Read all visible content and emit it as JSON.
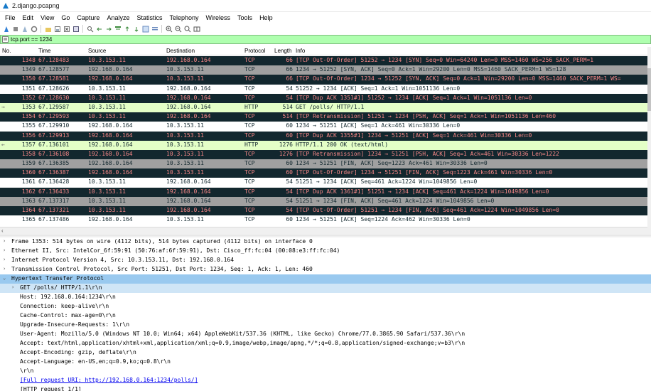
{
  "window": {
    "title": "2.django.pcapng"
  },
  "menu": [
    "File",
    "Edit",
    "View",
    "Go",
    "Capture",
    "Analyze",
    "Statistics",
    "Telephony",
    "Wireless",
    "Tools",
    "Help"
  ],
  "filter": {
    "value": "tcp.port == 1234"
  },
  "columns": {
    "no": "No.",
    "time": "Time",
    "source": "Source",
    "destination": "Destination",
    "protocol": "Protocol",
    "length": "Length",
    "info": "Info"
  },
  "packets": [
    {
      "no": "1348",
      "time": "67.128483",
      "src": "10.3.153.11",
      "dst": "192.168.0.164",
      "proto": "TCP",
      "len": "66",
      "info": "[TCP Out-Of-Order] 51252 → 1234 [SYN] Seq=0 Win=64240 Len=0 MSS=1460 WS=256 SACK_PERM=1",
      "style": "dark",
      "mark": ""
    },
    {
      "no": "1349",
      "time": "67.128577",
      "src": "192.168.0.164",
      "dst": "10.3.153.11",
      "proto": "TCP",
      "len": "66",
      "info": "1234 → 51252 [SYN, ACK] Seq=0 Ack=1 Win=29200 Len=0 MSS=1460 SACK_PERM=1 WS=128",
      "style": "gray",
      "mark": ""
    },
    {
      "no": "1350",
      "time": "67.128581",
      "src": "192.168.0.164",
      "dst": "10.3.153.11",
      "proto": "TCP",
      "len": "66",
      "info": "[TCP Out-Of-Order] 1234 → 51252 [SYN, ACK] Seq=0 Ack=1 Win=29200 Len=0 MSS=1460 SACK_PERM=1 WS=",
      "style": "dark",
      "mark": ""
    },
    {
      "no": "1351",
      "time": "67.128626",
      "src": "10.3.153.11",
      "dst": "192.168.0.164",
      "proto": "TCP",
      "len": "54",
      "info": "51252 → 1234 [ACK] Seq=1 Ack=1 Win=1051136 Len=0",
      "style": "white",
      "mark": ""
    },
    {
      "no": "1352",
      "time": "67.128630",
      "src": "10.3.153.11",
      "dst": "192.168.0.164",
      "proto": "TCP",
      "len": "54",
      "info": "[TCP Dup ACK 1351#1] 51252 → 1234 [ACK] Seq=1 Ack=1 Win=1051136 Len=0",
      "style": "dark",
      "mark": ""
    },
    {
      "no": "1353",
      "time": "67.129587",
      "src": "10.3.153.11",
      "dst": "192.168.0.164",
      "proto": "HTTP",
      "len": "514",
      "info": "GET /polls/ HTTP/1.1",
      "style": "selected",
      "mark": "→"
    },
    {
      "no": "1354",
      "time": "67.129593",
      "src": "10.3.153.11",
      "dst": "192.168.0.164",
      "proto": "TCP",
      "len": "514",
      "info": "[TCP Retransmission] 51251 → 1234 [PSH, ACK] Seq=1 Ack=1 Win=1051136 Len=460",
      "style": "dark",
      "mark": ""
    },
    {
      "no": "1355",
      "time": "67.129910",
      "src": "192.168.0.164",
      "dst": "10.3.153.11",
      "proto": "TCP",
      "len": "60",
      "info": "1234 → 51251 [ACK] Seq=1 Ack=461 Win=30336 Len=0",
      "style": "white",
      "mark": ""
    },
    {
      "no": "1356",
      "time": "67.129913",
      "src": "192.168.0.164",
      "dst": "10.3.153.11",
      "proto": "TCP",
      "len": "60",
      "info": "[TCP Dup ACK 1355#1] 1234 → 51251 [ACK] Seq=1 Ack=461 Win=30336 Len=0",
      "style": "dark",
      "mark": ""
    },
    {
      "no": "1357",
      "time": "67.136101",
      "src": "192.168.0.164",
      "dst": "10.3.153.11",
      "proto": "HTTP",
      "len": "1276",
      "info": "HTTP/1.1 200 OK  (text/html)",
      "style": "green",
      "mark": "←"
    },
    {
      "no": "1358",
      "time": "67.136108",
      "src": "192.168.0.164",
      "dst": "10.3.153.11",
      "proto": "TCP",
      "len": "1276",
      "info": "[TCP Retransmission] 1234 → 51251 [PSH, ACK] Seq=1 Ack=461 Win=30336 Len=1222",
      "style": "dark",
      "mark": ""
    },
    {
      "no": "1359",
      "time": "67.136385",
      "src": "192.168.0.164",
      "dst": "10.3.153.11",
      "proto": "TCP",
      "len": "60",
      "info": "1234 → 51251 [FIN, ACK] Seq=1223 Ack=461 Win=30336 Len=0",
      "style": "gray",
      "mark": ""
    },
    {
      "no": "1360",
      "time": "67.136387",
      "src": "192.168.0.164",
      "dst": "10.3.153.11",
      "proto": "TCP",
      "len": "60",
      "info": "[TCP Out-Of-Order] 1234 → 51251 [FIN, ACK] Seq=1223 Ack=461 Win=30336 Len=0",
      "style": "dark",
      "mark": ""
    },
    {
      "no": "1361",
      "time": "67.136428",
      "src": "10.3.153.11",
      "dst": "192.168.0.164",
      "proto": "TCP",
      "len": "54",
      "info": "51251 → 1234 [ACK] Seq=461 Ack=1224 Win=1049856 Len=0",
      "style": "white",
      "mark": ""
    },
    {
      "no": "1362",
      "time": "67.136433",
      "src": "10.3.153.11",
      "dst": "192.168.0.164",
      "proto": "TCP",
      "len": "54",
      "info": "[TCP Dup ACK 1361#1] 51251 → 1234 [ACK] Seq=461 Ack=1224 Win=1049856 Len=0",
      "style": "dark",
      "mark": ""
    },
    {
      "no": "1363",
      "time": "67.137317",
      "src": "10.3.153.11",
      "dst": "192.168.0.164",
      "proto": "TCP",
      "len": "54",
      "info": "51251 → 1234 [FIN, ACK] Seq=461 Ack=1224 Win=1049856 Len=0",
      "style": "gray",
      "mark": ""
    },
    {
      "no": "1364",
      "time": "67.137321",
      "src": "10.3.153.11",
      "dst": "192.168.0.164",
      "proto": "TCP",
      "len": "54",
      "info": "[TCP Out-Of-Order] 51251 → 1234 [FIN, ACK] Seq=461 Ack=1224 Win=1049856 Len=0",
      "style": "dark",
      "mark": ""
    },
    {
      "no": "1365",
      "time": "67.137486",
      "src": "192.168.0.164",
      "dst": "10.3.153.11",
      "proto": "TCP",
      "len": "60",
      "info": "1234 → 51251 [ACK] Seq=1224 Ack=462 Win=30336 Len=0",
      "style": "white",
      "mark": ""
    }
  ],
  "details": [
    {
      "text": "Frame 1353: 514 bytes on wire (4112 bits), 514 bytes captured (4112 bits) on interface 0",
      "indent": 0,
      "exp": "›",
      "style": ""
    },
    {
      "text": "Ethernet II, Src: IntelCor_6f:59:91 (50:76:af:6f:59:91), Dst: Cisco_ff:fc:04 (00:08:e3:ff:fc:04)",
      "indent": 0,
      "exp": "›",
      "style": ""
    },
    {
      "text": "Internet Protocol Version 4, Src: 10.3.153.11, Dst: 192.168.0.164",
      "indent": 0,
      "exp": "›",
      "style": ""
    },
    {
      "text": "Transmission Control Protocol, Src Port: 51251, Dst Port: 1234, Seq: 1, Ack: 1, Len: 460",
      "indent": 0,
      "exp": "›",
      "style": ""
    },
    {
      "text": "Hypertext Transfer Protocol",
      "indent": 0,
      "exp": "⌄",
      "style": "sel"
    },
    {
      "text": "GET /polls/ HTTP/1.1\\r\\n",
      "indent": 1,
      "exp": "›",
      "style": "subsel"
    },
    {
      "text": "Host: 192.168.0.164:1234\\r\\n",
      "indent": 1,
      "exp": "",
      "style": ""
    },
    {
      "text": "Connection: keep-alive\\r\\n",
      "indent": 1,
      "exp": "",
      "style": ""
    },
    {
      "text": "Cache-Control: max-age=0\\r\\n",
      "indent": 1,
      "exp": "",
      "style": ""
    },
    {
      "text": "Upgrade-Insecure-Requests: 1\\r\\n",
      "indent": 1,
      "exp": "",
      "style": ""
    },
    {
      "text": "User-Agent: Mozilla/5.0 (Windows NT 10.0; Win64; x64) AppleWebKit/537.36 (KHTML, like Gecko) Chrome/77.0.3865.90 Safari/537.36\\r\\n",
      "indent": 1,
      "exp": "",
      "style": ""
    },
    {
      "text": "Accept: text/html,application/xhtml+xml,application/xml;q=0.9,image/webp,image/apng,*/*;q=0.8,application/signed-exchange;v=b3\\r\\n",
      "indent": 1,
      "exp": "",
      "style": ""
    },
    {
      "text": "Accept-Encoding: gzip, deflate\\r\\n",
      "indent": 1,
      "exp": "",
      "style": ""
    },
    {
      "text": "Accept-Language: en-US,en;q=0.9,ko;q=0.8\\r\\n",
      "indent": 1,
      "exp": "",
      "style": ""
    },
    {
      "text": "\\r\\n",
      "indent": 1,
      "exp": "",
      "style": ""
    },
    {
      "text": "[Full request URI: http://192.168.0.164:1234/polls/]",
      "indent": 1,
      "exp": "",
      "style": "link"
    },
    {
      "text": "[HTTP request 1/1]",
      "indent": 1,
      "exp": "",
      "style": ""
    }
  ],
  "toolbar_icons": [
    "start-capture-icon",
    "stop-capture-icon",
    "restart-capture-icon",
    "capture-options-icon",
    "open-file-icon",
    "save-file-icon",
    "close-file-icon",
    "reload-file-icon",
    "find-packet-icon",
    "go-back-icon",
    "go-forward-icon",
    "go-to-packet-icon",
    "go-first-icon",
    "go-last-icon",
    "autoscroll-icon",
    "colorize-icon",
    "zoom-in-icon",
    "zoom-out-icon",
    "normal-size-icon",
    "resize-columns-icon"
  ],
  "colors": {
    "dark_row_bg": "#12272e",
    "dark_row_fg": "#f78787",
    "http_row_bg": "#e4ffc7",
    "gray_row_bg": "#a0a0a0",
    "filter_bg": "#afffaf",
    "detail_selected": "#99c9ef"
  }
}
